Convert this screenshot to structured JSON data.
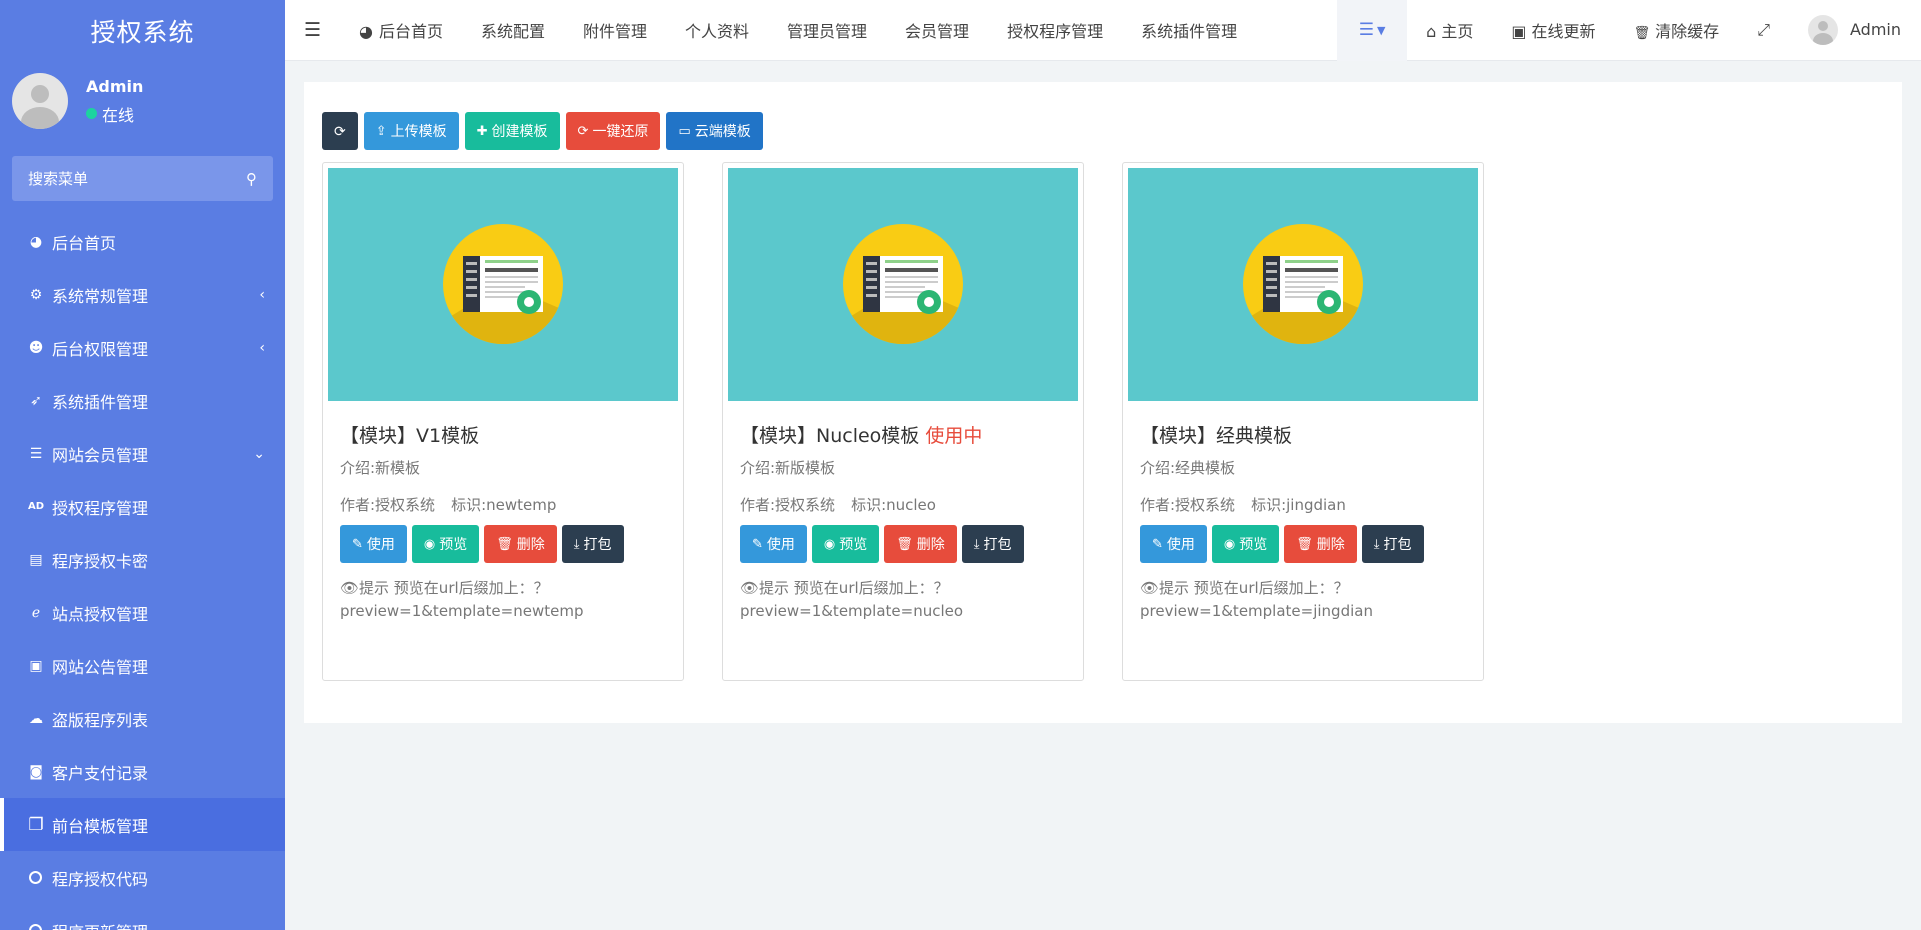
{
  "brand": "授权系统",
  "user": {
    "name": "Admin",
    "status": "在线"
  },
  "sidebar": {
    "search_placeholder": "搜索菜单",
    "items": [
      {
        "label": "后台首页",
        "icon": "dashboard-icon",
        "glyph": "◕",
        "arrow": ""
      },
      {
        "label": "系统常规管理",
        "icon": "gears-icon",
        "glyph": "⚙",
        "arrow": "‹"
      },
      {
        "label": "后台权限管理",
        "icon": "users-icon",
        "glyph": "☻",
        "arrow": "‹"
      },
      {
        "label": "系统插件管理",
        "icon": "rocket-icon",
        "glyph": "➶",
        "arrow": ""
      },
      {
        "label": "网站会员管理",
        "icon": "list-icon",
        "glyph": "☰",
        "arrow": "⌄"
      },
      {
        "label": "授权程序管理",
        "icon": "ad-icon",
        "glyph": "AD",
        "arrow": ""
      },
      {
        "label": "程序授权卡密",
        "icon": "id-card-icon",
        "glyph": "▤",
        "arrow": ""
      },
      {
        "label": "站点授权管理",
        "icon": "ie-icon",
        "glyph": "ℯ",
        "arrow": ""
      },
      {
        "label": "网站公告管理",
        "icon": "vimeo-icon",
        "glyph": "▣",
        "arrow": ""
      },
      {
        "label": "盗版程序列表",
        "icon": "ghost-icon",
        "glyph": "☁",
        "arrow": ""
      },
      {
        "label": "客户支付记录",
        "icon": "google-plus-icon",
        "glyph": "◙",
        "arrow": ""
      },
      {
        "label": "前台模板管理",
        "icon": "clone-icon",
        "glyph": "❐",
        "arrow": "",
        "active": true
      },
      {
        "label": "程序授权代码",
        "icon": "circle-icon",
        "glyph": "",
        "arrow": ""
      },
      {
        "label": "程序更新管理",
        "icon": "circle-icon",
        "glyph": "",
        "arrow": ""
      }
    ]
  },
  "topnav": {
    "items": [
      {
        "label": "后台首页",
        "icon": "dashboard-icon",
        "glyph": "◕"
      },
      {
        "label": "系统配置"
      },
      {
        "label": "附件管理"
      },
      {
        "label": "个人资料"
      },
      {
        "label": "管理员管理"
      },
      {
        "label": "会员管理"
      },
      {
        "label": "授权程序管理"
      },
      {
        "label": "系统插件管理"
      }
    ],
    "right": [
      {
        "label": "主页",
        "icon": "home-icon",
        "glyph": "⌂"
      },
      {
        "label": "在线更新",
        "icon": "vimeo-icon",
        "glyph": "▣"
      },
      {
        "label": "清除缓存",
        "icon": "trash-icon",
        "glyph": "🗑"
      }
    ],
    "admin": "Admin"
  },
  "toolbar": {
    "refresh": "",
    "upload": "上传模板",
    "create": "创建模板",
    "restore": "一键还原",
    "cloud": "云端模板"
  },
  "cards": [
    {
      "title": "【模块】V1模板",
      "status": "",
      "desc": "介绍:新模板",
      "author": "作者:授权系统",
      "ident": "标识:newtemp",
      "tip_line1": "👁提示 预览在url后缀加上：？",
      "tip_line2": "preview=1&template=newtemp"
    },
    {
      "title": "【模块】Nucleo模板",
      "status": "使用中",
      "desc": "介绍:新版模板",
      "author": "作者:授权系统",
      "ident": "标识:nucleo",
      "tip_line1": "👁提示 预览在url后缀加上：？",
      "tip_line2": "preview=1&template=nucleo"
    },
    {
      "title": "【模块】经典模板",
      "status": "",
      "desc": "介绍:经典模板",
      "author": "作者:授权系统",
      "ident": "标识:jingdian",
      "tip_line1": "👁提示 预览在url后缀加上：？",
      "tip_line2": "preview=1&template=jingdian"
    }
  ],
  "card_actions": {
    "use": "使用",
    "preview": "预览",
    "delete": "删除",
    "pack": "打包"
  },
  "colors": {
    "sidebar": "#5a7de3",
    "accent_red": "#e74c3c",
    "thumb_bg": "#5bc8cc"
  }
}
